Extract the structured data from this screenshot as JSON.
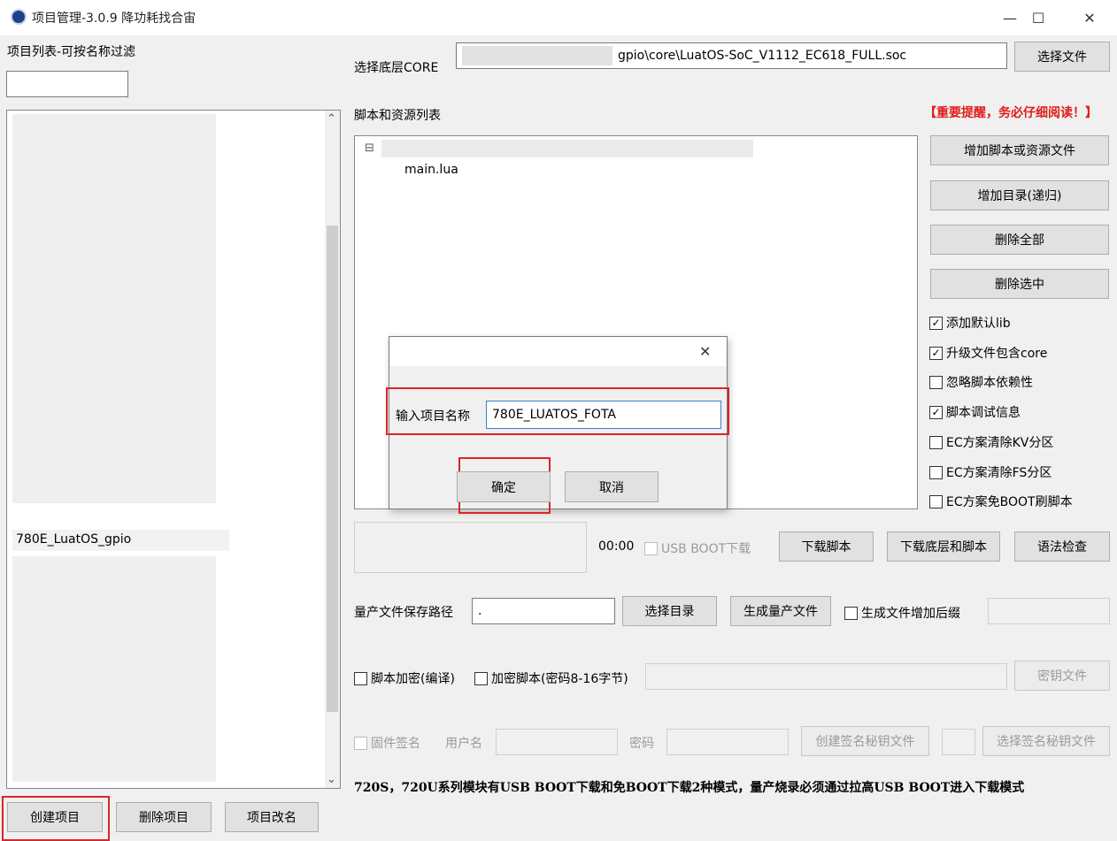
{
  "window": {
    "title": "项目管理-3.0.9 降功耗找合宙",
    "minimize": "—",
    "maximize": "☐",
    "close": "✕"
  },
  "left": {
    "filter_label": "项目列表-可按名称过滤",
    "filter_value": "",
    "visible_project": "780E_LuatOS_gpio",
    "buttons": {
      "create": "创建项目",
      "delete": "删除项目",
      "rename": "项目改名"
    }
  },
  "core": {
    "label": "选择底层CORE",
    "path": "gpio\\core\\LuatOS-SoC_V1112_EC618_FULL.soc",
    "select_button": "选择文件"
  },
  "scripts": {
    "label": "脚本和资源列表",
    "warning": "【重要提醒，务必仔细阅读！】",
    "tree_expander": "⊟",
    "tree_child": "main.lua",
    "buttons": {
      "add_script": "增加脚本或资源文件",
      "add_dir": "增加目录(递归)",
      "delete_all": "删除全部",
      "delete_selected": "删除选中"
    }
  },
  "options": {
    "add_default_lib": {
      "label": "添加默认lib",
      "checked": true
    },
    "include_core": {
      "label": "升级文件包含core",
      "checked": true
    },
    "ignore_dep": {
      "label": "忽略脚本依赖性",
      "checked": false
    },
    "debug_info": {
      "label": "脚本调试信息",
      "checked": true
    },
    "clear_kv": {
      "label": "EC方案清除KV分区",
      "checked": false
    },
    "clear_fs": {
      "label": "EC方案清除FS分区",
      "checked": false
    },
    "no_boot": {
      "label": "EC方案免BOOT刷脚本",
      "checked": false
    },
    "check_mark": "✓"
  },
  "download": {
    "time": "00:00",
    "usb_boot": "USB BOOT下载",
    "download_script": "下载脚本",
    "download_all": "下载底层和脚本",
    "syntax_check": "语法检查"
  },
  "production": {
    "path_label": "量产文件保存路径",
    "path_value": ".",
    "select_dir": "选择目录",
    "generate": "生成量产文件",
    "suffix": "生成文件增加后缀"
  },
  "encrypt": {
    "compile": "脚本加密(编译)",
    "encrypt_key": "加密脚本(密码8-16字节)",
    "key_file": "密钥文件"
  },
  "signature": {
    "firmware_sign": "固件签名",
    "username": "用户名",
    "password": "密码",
    "create_key": "创建签名秘钥文件",
    "select_key": "选择签名秘钥文件"
  },
  "notice": "720S，720U系列模块有USB BOOT下载和免BOOT下载2种模式，量产烧录必须通过拉高USB BOOT进入下载模式",
  "dialog": {
    "close": "✕",
    "label": "输入项目名称",
    "value": "780E_LUATOS_FOTA",
    "ok": "确定",
    "cancel": "取消"
  },
  "icons": {
    "scroll_up": "⌃",
    "scroll_down": "⌄"
  }
}
